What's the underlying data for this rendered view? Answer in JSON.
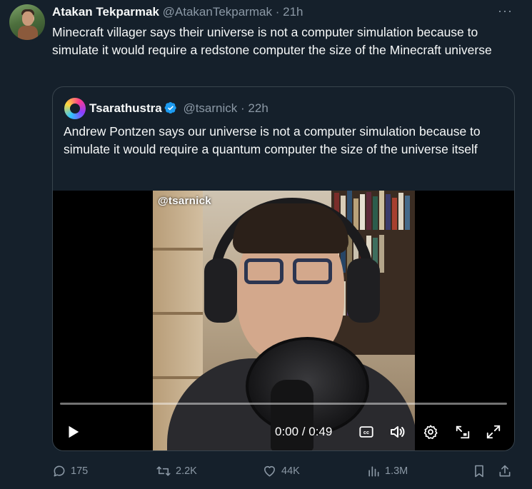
{
  "tweet": {
    "author_name": "Atakan Tekparmak",
    "author_handle": "@AtakanTekparmak",
    "separator": "·",
    "time": "21h",
    "more_label": "···",
    "text": "Minecraft villager says their universe is not a computer simulation because to simulate it would require a redstone computer the size of the Minecraft universe"
  },
  "quote": {
    "author_name": "Tsarathustra",
    "author_handle": "@tsarnick",
    "separator": "·",
    "time": "22h",
    "text": "Andrew Pontzen says our universe is not a computer simulation because to simulate it would require a quantum computer the size of the universe itself"
  },
  "video": {
    "watermark": "@tsarnick",
    "time_readout": "0:00 / 0:49",
    "progress": 0,
    "controls": [
      "play-icon",
      "captions-icon",
      "volume-icon",
      "settings-icon",
      "pip-icon",
      "fullscreen-icon"
    ]
  },
  "actions": {
    "replies": "175",
    "retweets": "2.2K",
    "likes": "44K",
    "views": "1.3M"
  },
  "colors": {
    "background": "#15202b",
    "text_primary": "#f7f9f9",
    "text_secondary": "#8b98a5",
    "border": "#38444d",
    "accent": "#1d9bf0"
  }
}
